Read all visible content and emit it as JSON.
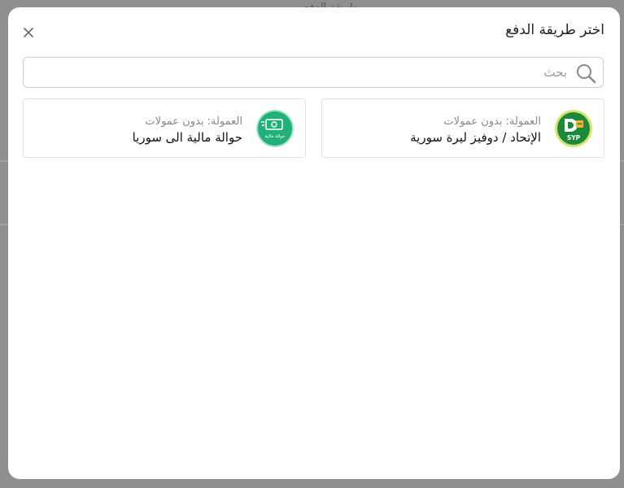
{
  "background": {
    "partial_text": "طريقة الدفع"
  },
  "modal": {
    "title": "اختر طريقة الدفع",
    "close_icon": "close-icon",
    "search": {
      "placeholder": "بحث",
      "value": "",
      "icon": "search-icon"
    }
  },
  "methods": [
    {
      "name": "الإتحاد / دوفيز ليرة سورية",
      "fee_label": "العمولة:",
      "fee_value": "بدون عمولات",
      "logo_text": "SYP",
      "logo_color": "#1a8a3a"
    },
    {
      "name": "حوالة مالية الى سوريا",
      "fee_label": "العمولة:",
      "fee_value": "بدون عمولات",
      "logo_text": "حوالة مالية",
      "logo_color": "#22b07a"
    }
  ],
  "colors": {
    "overlay": "#8f8f8f",
    "modal_bg": "#ffffff",
    "border": "#e3e3e3",
    "muted_text": "#888888",
    "gold": "#f2b630"
  }
}
